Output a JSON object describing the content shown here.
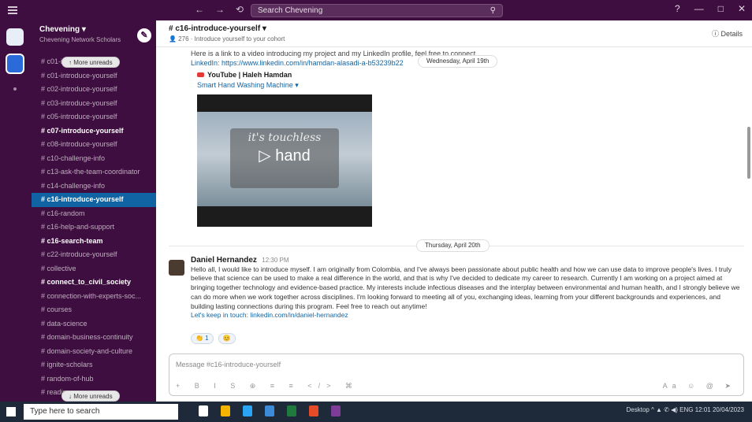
{
  "titlebar": {
    "nav_back": "←",
    "nav_forward": "→",
    "history": "⟲",
    "search_placeholder": "Search Chevening",
    "search_icon": "search-icon",
    "help": "?",
    "minimize": "—",
    "maximize": "□",
    "close": "✕"
  },
  "workspace": {
    "name": "Chevening ▾",
    "subtitle": "Chevening Network Scholars",
    "compose_icon": "✎"
  },
  "sidebar": {
    "channels": [
      {
        "label": "# c01-introduce-yourself",
        "style": "normal"
      },
      {
        "label": "# c01-introduce-yourself",
        "style": "normal"
      },
      {
        "label": "# c02-introduce-yourself",
        "style": "normal"
      },
      {
        "label": "# c03-introduce-yourself",
        "style": "normal"
      },
      {
        "label": "# c05-introduce-yourself",
        "style": "normal"
      },
      {
        "label": "# c07-introduce-yourself",
        "style": "bold"
      },
      {
        "label": "# c08-introduce-yourself",
        "style": "normal"
      },
      {
        "label": "# c10-challenge-info",
        "style": "normal"
      },
      {
        "label": "# c13-ask-the-team-coordinator",
        "style": "normal"
      },
      {
        "label": "# c14-challenge-info",
        "style": "normal"
      },
      {
        "label": "# c16-introduce-yourself",
        "style": "active"
      },
      {
        "label": "# c16-random",
        "style": "normal"
      },
      {
        "label": "# c16-help-and-support",
        "style": "normal"
      },
      {
        "label": "# c16-search-team",
        "style": "bold"
      },
      {
        "label": "# c22-introduce-yourself",
        "style": "normal"
      },
      {
        "label": "# collective",
        "style": "normal"
      },
      {
        "label": "# connect_to_civil_society",
        "style": "bold"
      },
      {
        "label": "# connection-with-experts-soc...",
        "style": "normal"
      },
      {
        "label": "# courses",
        "style": "normal"
      },
      {
        "label": "# data-science",
        "style": "normal"
      },
      {
        "label": "# domain-business-continuity",
        "style": "normal"
      },
      {
        "label": "# domain-society-and-culture",
        "style": "normal"
      },
      {
        "label": "# ignite-scholars",
        "style": "normal"
      },
      {
        "label": "# random-of-hub",
        "style": "normal"
      },
      {
        "label": "# reading",
        "style": "normal"
      }
    ],
    "unread_pill_top": "↑ More unreads",
    "unread_pill_bottom": "↓ More unreads"
  },
  "channel": {
    "name": "# c16-introduce-yourself ▾",
    "meta": "👤 276 · Introduce yourself to your cohort",
    "details": "ⓘ Details"
  },
  "messages": {
    "first_text": "Here is a link to a video introducing my project and my LinkedIn profile, feel free to connect.",
    "first_link": "LinkedIn: https://www.linkedin.com/in/hamdan-alasadi-a-b53239b22",
    "youtube_source": "YouTube | Haleh Hamdan",
    "video_title": "Smart Hand Washing Machine ▾",
    "video_overlay_1": "it's touchless",
    "video_overlay_2": "▷ hand",
    "date_divider_1": "Wednesday, April 19th",
    "date_divider_2": "Thursday, April 20th",
    "second_author": "Daniel Hernandez",
    "second_time": "12:30 PM",
    "second_body": "Hello all, I would like to introduce myself. I am originally from Colombia, and I've always been passionate about public health and how we can use data to improve people's lives. I truly believe that science can be used to make a real difference in the world, and that is why I've decided to dedicate my career to research. Currently I am working on a project aimed at bringing together technology and evidence-based practice. My interests include infectious diseases and the interplay between environmental and human health, and I strongly believe we can do more when we work together across disciplines. I'm looking forward to meeting all of you, exchanging ideas, learning from your different backgrounds and experiences, and building lasting connections during this program. Feel free to reach out anytime!",
    "second_link": "Let's keep in touch: linkedin.com/in/daniel-hernandez",
    "reactions": [
      "👏 1",
      "😊"
    ]
  },
  "composer": {
    "placeholder": "Message #c16-introduce-yourself",
    "tools": "+ B I S ⊕ ≡ ≡ </> ⌘",
    "send_tools": "Aa ☺ @ ➤"
  },
  "taskbar": {
    "search_placeholder": "Type here to search",
    "tray": "Desktop ^ ▲ ✆ ◀) ENG 12:01 20/04/2023"
  }
}
